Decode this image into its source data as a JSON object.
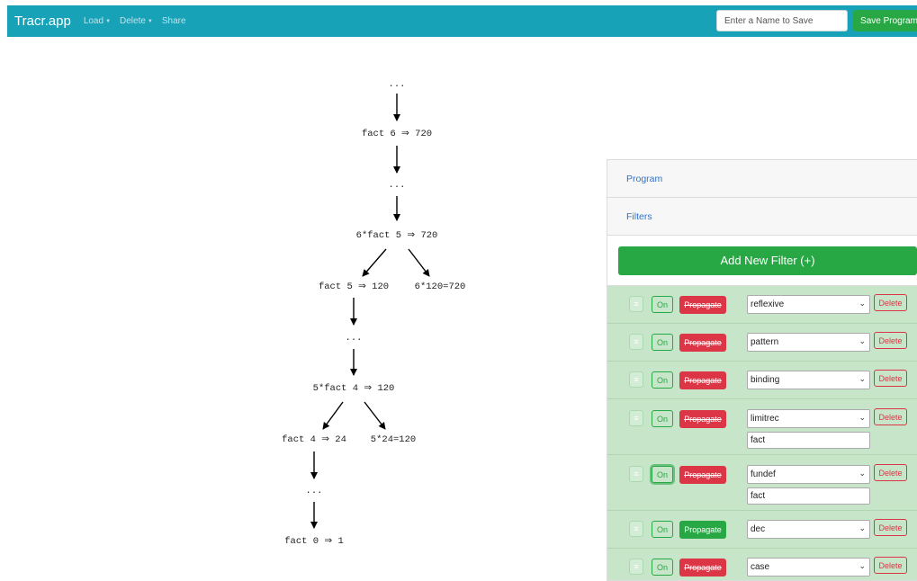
{
  "navbar": {
    "brand": "Tracr.app",
    "links": [
      {
        "label": "Load",
        "has_dropdown": true
      },
      {
        "label": "Delete",
        "has_dropdown": true
      },
      {
        "label": "Share",
        "has_dropdown": false
      }
    ],
    "name_input": {
      "placeholder": "Enter a Name to Save",
      "value": ""
    },
    "save_label": "Save Program"
  },
  "tree": {
    "nodes": [
      "...",
      "fact 6 ⇒ 720",
      "...",
      "6*fact 5 ⇒ 720",
      "fact 5 ⇒ 120",
      "6*120=720",
      "...",
      "5*fact 4 ⇒ 120",
      "fact 4 ⇒ 24",
      "5*24=120",
      "...",
      "fact 0 ⇒ 1"
    ]
  },
  "panel": {
    "program_label": "Program",
    "filters_label": "Filters",
    "add_filter_label": "Add New Filter (+)",
    "handle_glyph": "≡",
    "on_label": "On",
    "propagate_label": "Propagate",
    "delete_label": "Delete",
    "filters": [
      {
        "type": "reflexive",
        "propagate": false,
        "arg": null,
        "focused": false
      },
      {
        "type": "pattern",
        "propagate": false,
        "arg": null,
        "focused": false
      },
      {
        "type": "binding",
        "propagate": false,
        "arg": null,
        "focused": false
      },
      {
        "type": "limitrec",
        "propagate": false,
        "arg": "fact",
        "focused": false
      },
      {
        "type": "fundef",
        "propagate": false,
        "arg": "fact",
        "focused": true
      },
      {
        "type": "dec",
        "propagate": true,
        "arg": null,
        "focused": false
      },
      {
        "type": "case",
        "propagate": false,
        "arg": null,
        "focused": false
      }
    ]
  },
  "colors": {
    "navbar": "#17a2b8",
    "success": "#28a745",
    "danger": "#dc3545",
    "filter_row_bg": "#c7e6c9",
    "link": "#2f73c9"
  }
}
